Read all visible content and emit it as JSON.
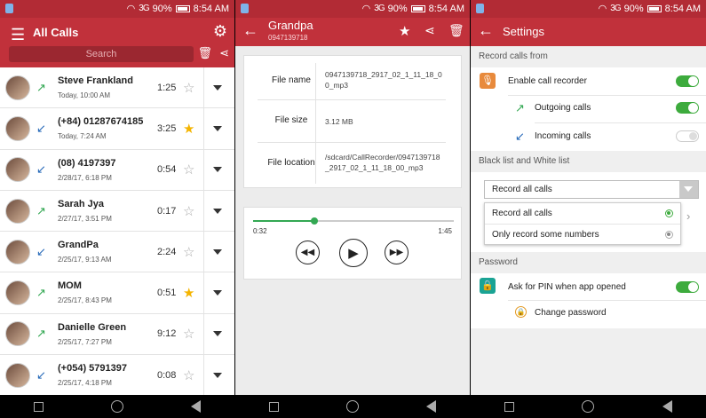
{
  "status": {
    "signal": "3G",
    "battery": "90%",
    "time": "8:54 AM"
  },
  "colors": {
    "primary": "#c1313b",
    "status_bar": "#b22b35",
    "accent_green": "#3dab3d",
    "star_on": "#f4b400",
    "incoming_blue": "#2468b8"
  },
  "all_calls": {
    "title": "All Calls",
    "search_placeholder": "Search",
    "icons": [
      "menu-icon",
      "gear-icon",
      "trash-icon",
      "share-icon"
    ],
    "calls": [
      {
        "name": "Steve Frankland",
        "date": "Today, 10:00 AM",
        "duration": "1:25",
        "direction": "outgoing",
        "starred": false
      },
      {
        "name": "(+84) 01287674185",
        "date": "Today, 7:24 AM",
        "duration": "3:25",
        "direction": "incoming",
        "starred": true
      },
      {
        "name": "(08) 4197397",
        "date": "2/28/17, 6:18 PM",
        "duration": "0:54",
        "direction": "incoming",
        "starred": false
      },
      {
        "name": "Sarah Jya",
        "date": "2/27/17, 3:51 PM",
        "duration": "0:17",
        "direction": "outgoing",
        "starred": false
      },
      {
        "name": "GrandPa",
        "date": "2/25/17, 9:13 AM",
        "duration": "2:24",
        "direction": "incoming",
        "starred": false
      },
      {
        "name": "MOM",
        "date": "2/25/17, 8:43 PM",
        "duration": "0:51",
        "direction": "outgoing",
        "starred": true
      },
      {
        "name": "Danielle Green",
        "date": "2/25/17, 7:27 PM",
        "duration": "9:12",
        "direction": "outgoing",
        "starred": false
      },
      {
        "name": "(+054) 5791397",
        "date": "2/25/17, 4:18 PM",
        "duration": "0:08",
        "direction": "incoming",
        "starred": false
      }
    ]
  },
  "detail": {
    "name": "Grandpa",
    "number": "0947139718",
    "rows": [
      {
        "label": "File name",
        "value": "0947139718_2917_02_1_11_18_00_mp3"
      },
      {
        "label": "File size",
        "value": "3.12 MB"
      },
      {
        "label": "File location",
        "value": "/sdcard/CallRecorder/0947139718_2917_02_1_11_18_00_mp3"
      }
    ],
    "player": {
      "current": "0:32",
      "total": "1:45",
      "progress": 0.305
    }
  },
  "settings": {
    "title": "Settings",
    "sections": {
      "record": "Record calls from",
      "list": "Black list and White list",
      "password": "Password"
    },
    "enable_recorder": {
      "label": "Enable call recorder",
      "on": true
    },
    "outgoing": {
      "label": "Outgoing calls",
      "on": true
    },
    "incoming": {
      "label": "Incoming calls",
      "on": false
    },
    "list_mode": {
      "selected": "Record all calls",
      "options": [
        "Record all calls",
        "Only record some numbers"
      ]
    },
    "pin": {
      "label": "Ask for PIN when app opened",
      "on": true
    },
    "change_password": "Change password"
  }
}
